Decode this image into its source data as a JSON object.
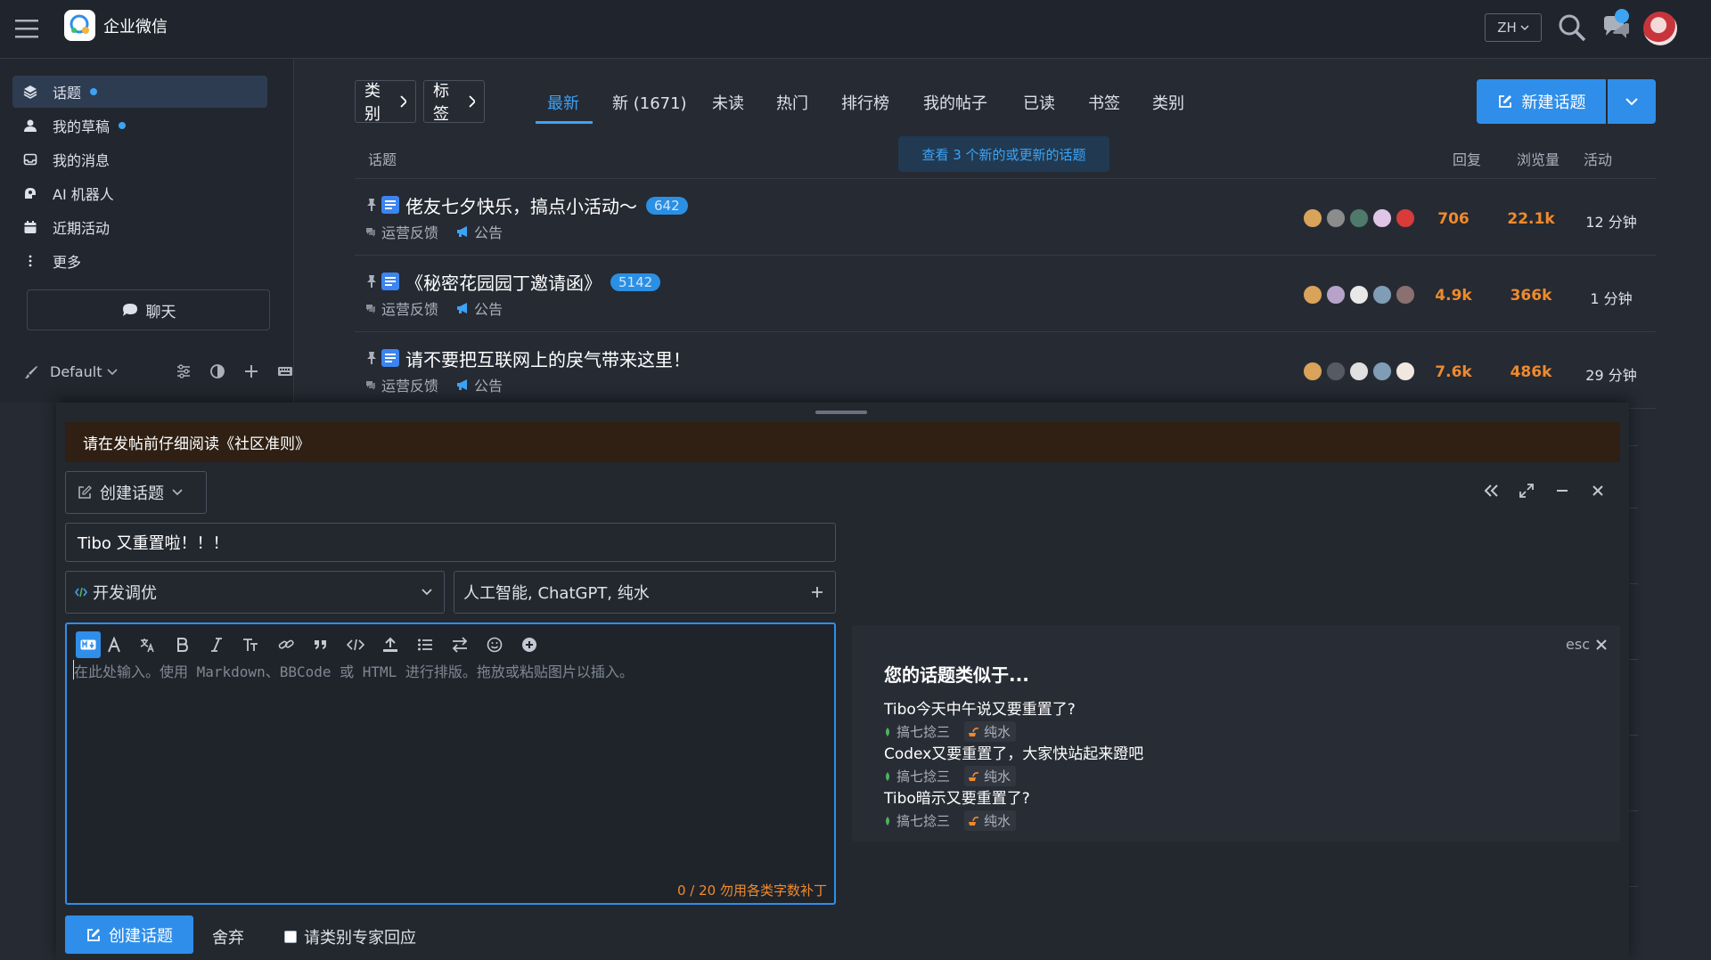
{
  "header": {
    "brand": "企业微信",
    "lang": "ZH"
  },
  "sidebar": {
    "items": [
      {
        "label": "话题",
        "icon": "layers-icon",
        "dot": true
      },
      {
        "label": "我的草稿",
        "icon": "user-icon",
        "dot": true
      },
      {
        "label": "我的消息",
        "icon": "inbox-icon",
        "dot": false
      },
      {
        "label": "AI 机器人",
        "icon": "robot-icon",
        "dot": false
      },
      {
        "label": "近期活动",
        "icon": "calendar-icon",
        "dot": false
      },
      {
        "label": "更多",
        "icon": "more-vertical-icon",
        "dot": false
      }
    ],
    "chat_label": "聊天",
    "theme_label": "Default"
  },
  "topics": {
    "category_btn": "类别",
    "tag_btn": "标签",
    "nav": [
      "最新",
      "新 (1671)",
      "未读",
      "热门",
      "排行榜",
      "我的帖子",
      "已读",
      "书签",
      "类别"
    ],
    "active_nav": "最新",
    "new_topic_label": "新建话题",
    "columns": {
      "topic": "话题",
      "replies": "回复",
      "views": "浏览量",
      "activity": "活动"
    },
    "banner": "查看 3 个新的或更新的话题",
    "rows": [
      {
        "title": "佬友七夕快乐，搞点小活动～",
        "badge": "642",
        "category": "运营反馈",
        "tag": "公告",
        "replies": "706",
        "views": "22.1k",
        "activity": "12 分钟",
        "avatars": [
          "#d9a35a",
          "#8c8c8c",
          "#4f7a6b",
          "#e0c6e6",
          "#d93a3a"
        ]
      },
      {
        "title": "《秘密花园园丁邀请函》",
        "badge": "5142",
        "category": "运营反馈",
        "tag": "公告",
        "replies": "4.9k",
        "views": "366k",
        "activity": "1 分钟",
        "avatars": [
          "#d9a35a",
          "#b7a3c9",
          "#e8e8e8",
          "#7f9db5",
          "#8a7070"
        ]
      },
      {
        "title": "请不要把互联网上的戾气带来这里！",
        "badge": "",
        "category": "运营反馈",
        "tag": "公告",
        "replies": "7.6k",
        "views": "486k",
        "activity": "29 分钟",
        "avatars": [
          "#d9a35a",
          "#555b63",
          "#e0e0e0",
          "#7f9db5",
          "#f2e7e0"
        ]
      }
    ]
  },
  "composer": {
    "notice": "请在发帖前仔细阅读《社区准则》",
    "action_label": "创建话题",
    "title_value": "Tibo 又重置啦！！！",
    "category": "开发调优",
    "tags": "人工智能, ChatGPT, 纯水",
    "placeholder": "在此处输入。使用 Markdown、BBCode 或 HTML 进行排版。拖放或粘贴图片以插入。",
    "counter": "0 / 20 勿用各类字数补丁",
    "submit_label": "创建话题",
    "discard_label": "舍弃",
    "expert_label": "请类别专家回应"
  },
  "similar": {
    "esc": "esc",
    "heading": "您的话题类似于...",
    "items": [
      {
        "title": "Tibo今天中午说又要重置了?",
        "category": "搞七捻三",
        "tag": "纯水"
      },
      {
        "title": "Codex又要重置了，大家快站起来蹬吧",
        "category": "搞七捻三",
        "tag": "纯水"
      },
      {
        "title": "Tibo暗示又要重置了?",
        "category": "搞七捻三",
        "tag": "纯水"
      }
    ]
  },
  "colors": {
    "accent": "#2f8eea",
    "stat": "#f08a2c",
    "category_dot": "#4fb35b"
  }
}
